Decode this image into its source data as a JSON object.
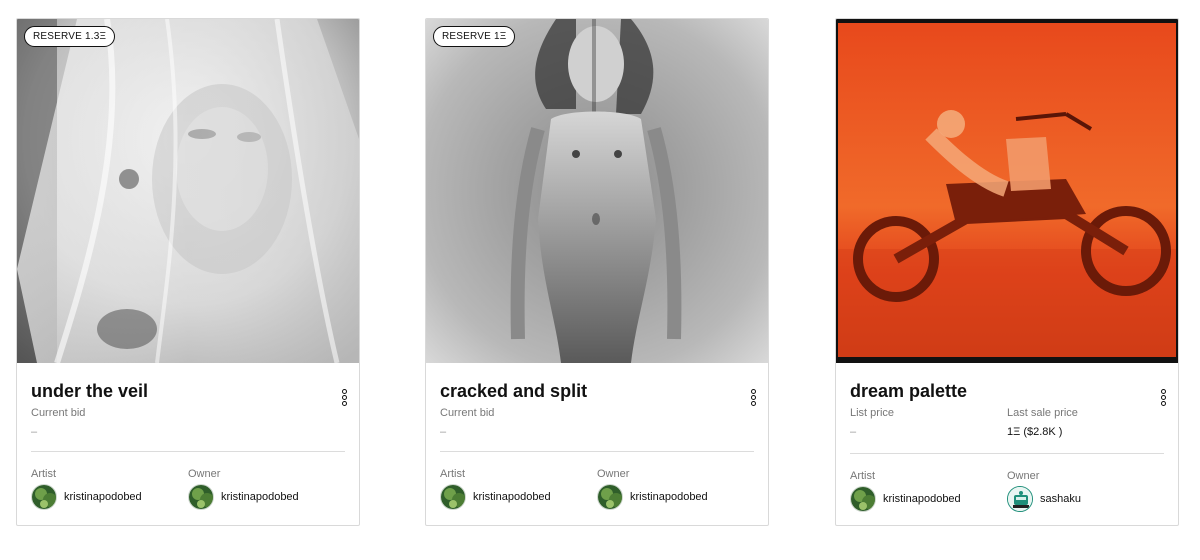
{
  "cards": [
    {
      "badge": "RESERVE 1.3Ξ",
      "title": "under the veil",
      "price_label": "Current bid",
      "price_value": "–",
      "artist_label": "Artist",
      "artist_name": "kristinapodobed",
      "owner_label": "Owner",
      "owner_name": "kristinapodobed"
    },
    {
      "badge": "RESERVE 1Ξ",
      "title": "cracked and split",
      "price_label": "Current bid",
      "price_value": "–",
      "artist_label": "Artist",
      "artist_name": "kristinapodobed",
      "owner_label": "Owner",
      "owner_name": "kristinapodobed"
    },
    {
      "title": "dream palette",
      "price_label": "List price",
      "price_value": "–",
      "last_sale_label": "Last sale price",
      "last_sale_value": "1Ξ ($2.8K )",
      "artist_label": "Artist",
      "artist_name": "kristinapodobed",
      "owner_label": "Owner",
      "owner_name": "sashaku"
    }
  ],
  "icons": {
    "menu": "vertical-ellipsis-icon",
    "artist_avatar": "green-foliage-avatar",
    "owner_avatar_sashaku": "teal-robot-avatar"
  },
  "colors": {
    "border": "#d9d9d9",
    "muted_text": "#777777",
    "accent_red": "#e2421b",
    "teal": "#1f8f7a"
  }
}
